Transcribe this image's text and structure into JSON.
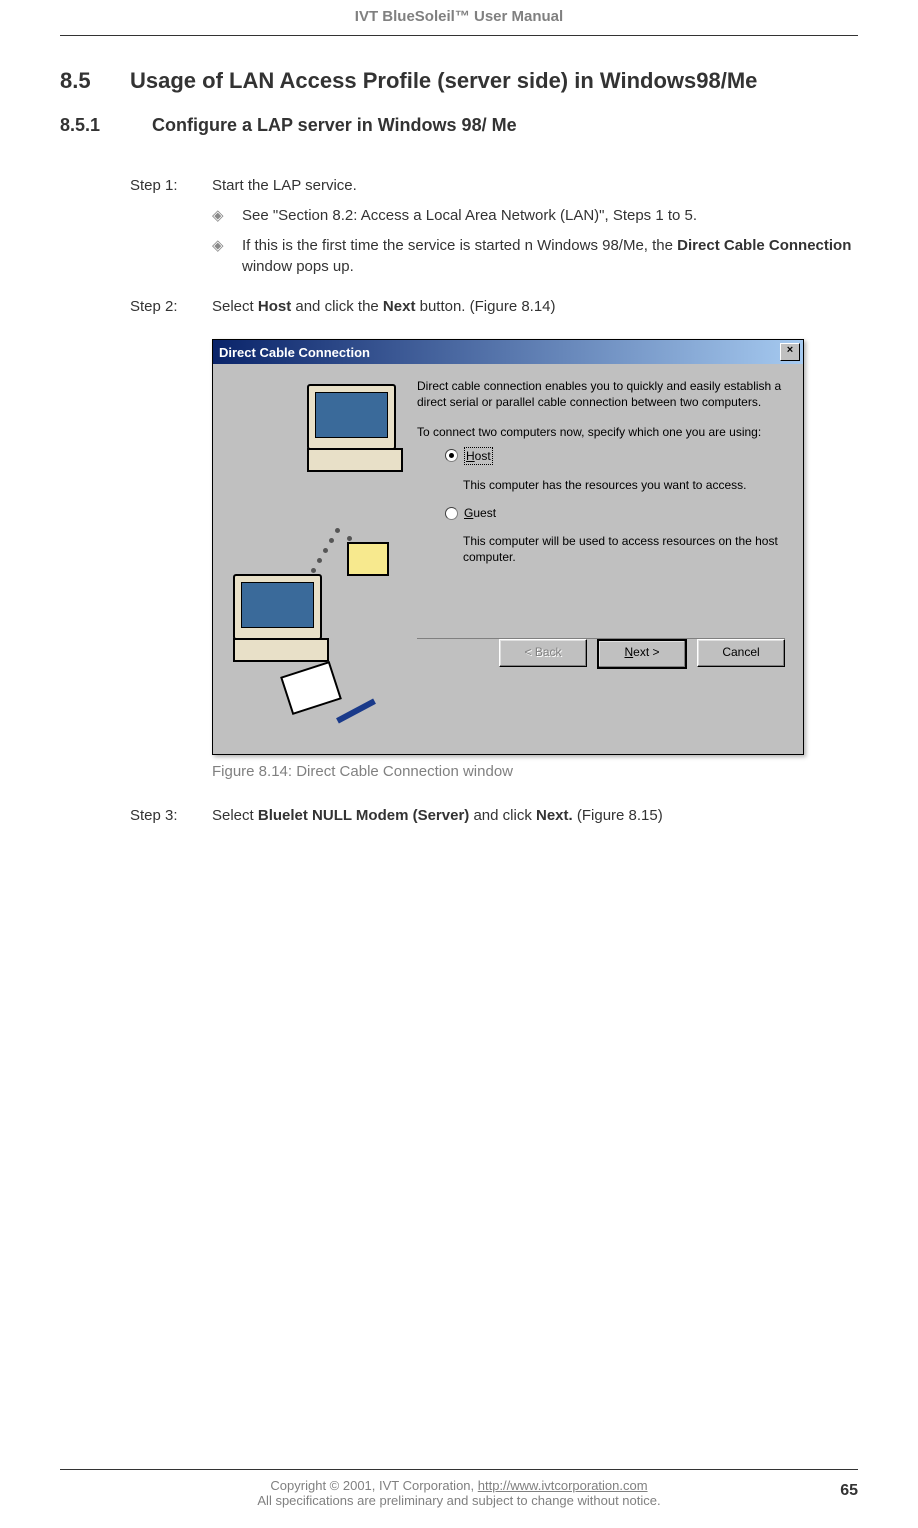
{
  "header": "IVT BlueSoleil™ User Manual",
  "section": {
    "num": "8.5",
    "title": "Usage of LAN Access Profile (server side) in Windows98/Me"
  },
  "subsection": {
    "num": "8.5.1",
    "title": "Configure a LAP server in Windows 98/ Me"
  },
  "steps": {
    "s1": {
      "label": "Step 1:",
      "text": "Start the LAP service.",
      "bullet1": "See \"Section 8.2: Access a Local Area Network (LAN)\", Steps 1 to 5.",
      "bullet2a": "If this is the first time the service is started n Windows 98/Me, the ",
      "bullet2b": "Direct Cable Connection",
      "bullet2c": " window pops up."
    },
    "s2": {
      "label": "Step 2:",
      "pre": "Select ",
      "b1": "Host",
      "mid": " and click the ",
      "b2": "Next",
      "post": " button. (Figure 8.14)"
    },
    "s3": {
      "label": "Step 3:",
      "pre": "Select ",
      "b1": "Bluelet NULL Modem (Server)",
      "mid": " and click ",
      "b2": "Next.",
      "post": " (Figure 8.15)"
    }
  },
  "dialog": {
    "title": "Direct Cable Connection",
    "intro": "Direct cable connection enables you to quickly and easily establish a direct serial or parallel cable connection between two computers.",
    "prompt": "To connect two computers now, specify which one you are using:",
    "host_label_u": "H",
    "host_label_rest": "ost",
    "host_desc": "This computer has the resources you want to access.",
    "guest_label_u": "G",
    "guest_label_rest": "uest",
    "guest_desc": "This computer will be used to access resources on the host computer.",
    "back": "< Back",
    "next_u": "N",
    "next_rest": "ext >",
    "cancel": "Cancel",
    "close": "×"
  },
  "figure_caption": "Figure 8.14: Direct Cable Connection window",
  "footer": {
    "line1a": "Copyright © 2001, IVT Corporation, ",
    "line1b": "http://www.ivtcorporation.com",
    "line2": "All specifications are preliminary and subject to change without notice.",
    "page": "65"
  }
}
